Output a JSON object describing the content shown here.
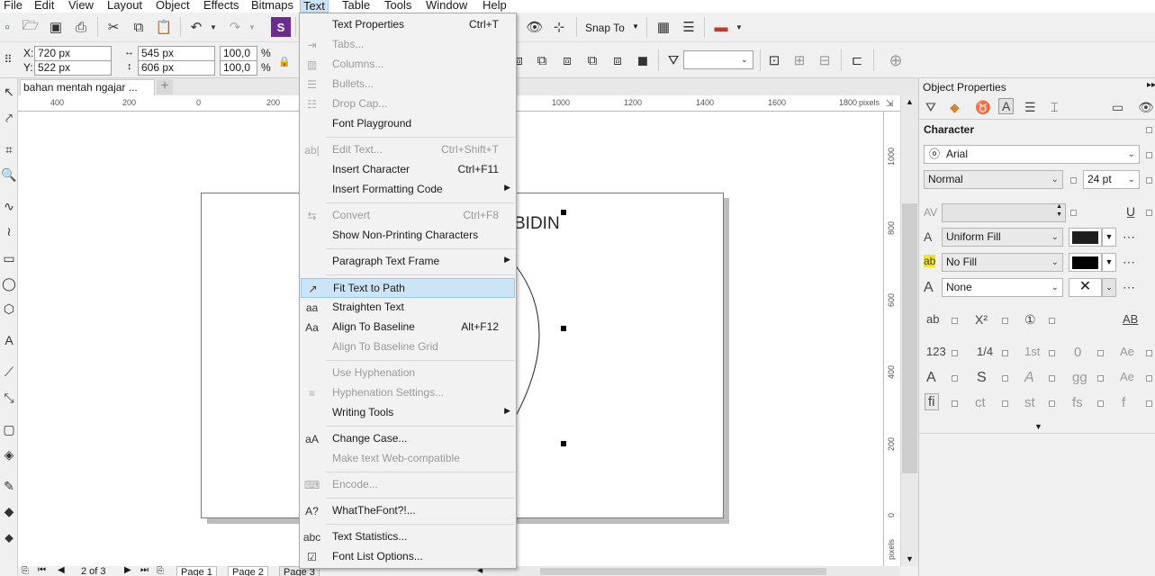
{
  "menubar": {
    "items": [
      "File",
      "Edit",
      "View",
      "Layout",
      "Object",
      "Effects",
      "Bitmaps",
      "Text",
      "Table",
      "Tools",
      "Window",
      "Help"
    ],
    "active": "Text"
  },
  "toolbar": {
    "snap_to": "Snap To",
    "x_label": "X:",
    "x_value": "720 px",
    "y_label": "Y:",
    "y_value": "522 px",
    "w_value": "545 px",
    "h_value": "606 px",
    "scale_w": "100,0",
    "scale_h": "100,0",
    "pct": "%"
  },
  "document": {
    "tab_title": "bahan mentah ngajar ...",
    "add_tab": "+",
    "canvas_text": "BIDIN",
    "pages_counter": "2 of 3",
    "pages": [
      "Page 1",
      "Page 2",
      "Page 3"
    ]
  },
  "ruler": {
    "h_labels": [
      "400",
      "200",
      "0",
      "200",
      "1000",
      "1200",
      "1400",
      "1600",
      "1800"
    ],
    "unit": "pixels",
    "v_labels": [
      "1000",
      "800",
      "600",
      "400",
      "200",
      "0"
    ],
    "v_unit": "pixels"
  },
  "text_menu": {
    "items": [
      {
        "label": "Text Properties",
        "shortcut": "Ctrl+T",
        "disabled": false,
        "icon": ""
      },
      {
        "label": "Tabs...",
        "shortcut": "",
        "disabled": true,
        "icon": "tabs-icon"
      },
      {
        "label": "Columns...",
        "shortcut": "",
        "disabled": true,
        "icon": "columns-icon"
      },
      {
        "label": "Bullets...",
        "shortcut": "",
        "disabled": true,
        "icon": "bullets-icon"
      },
      {
        "label": "Drop Cap...",
        "shortcut": "",
        "disabled": true,
        "icon": "drop-cap-icon"
      },
      {
        "label": "Font Playground",
        "shortcut": "",
        "disabled": false,
        "icon": ""
      },
      {
        "sep": true
      },
      {
        "label": "Edit Text...",
        "shortcut": "Ctrl+Shift+T",
        "disabled": true,
        "icon": "edit-text-icon"
      },
      {
        "label": "Insert Character",
        "shortcut": "Ctrl+F11",
        "disabled": false,
        "icon": ""
      },
      {
        "label": "Insert Formatting Code",
        "shortcut": "",
        "disabled": false,
        "icon": "",
        "submenu": true
      },
      {
        "sep": true
      },
      {
        "label": "Convert",
        "shortcut": "Ctrl+F8",
        "disabled": true,
        "icon": "convert-icon"
      },
      {
        "label": "Show Non-Printing Characters",
        "shortcut": "",
        "disabled": false,
        "icon": ""
      },
      {
        "sep": true
      },
      {
        "label": "Paragraph Text Frame",
        "shortcut": "",
        "disabled": false,
        "icon": "",
        "submenu": true
      },
      {
        "sep": true
      },
      {
        "label": "Fit Text to Path",
        "shortcut": "",
        "disabled": false,
        "icon": "fit-text-to-path-icon",
        "highlighted": true
      },
      {
        "label": "Straighten Text",
        "shortcut": "",
        "disabled": false,
        "icon": "straighten-text-icon"
      },
      {
        "label": "Align To Baseline",
        "shortcut": "Alt+F12",
        "disabled": false,
        "icon": "align-baseline-icon"
      },
      {
        "label": "Align To Baseline Grid",
        "shortcut": "",
        "disabled": true,
        "icon": ""
      },
      {
        "sep": true
      },
      {
        "label": "Use Hyphenation",
        "shortcut": "",
        "disabled": true,
        "icon": ""
      },
      {
        "label": "Hyphenation Settings...",
        "shortcut": "",
        "disabled": true,
        "icon": "hyphenation-icon"
      },
      {
        "label": "Writing Tools",
        "shortcut": "",
        "disabled": false,
        "icon": "",
        "submenu": true
      },
      {
        "sep": true
      },
      {
        "label": "Change Case...",
        "shortcut": "",
        "disabled": false,
        "icon": "change-case-icon"
      },
      {
        "label": "Make text Web-compatible",
        "shortcut": "",
        "disabled": true,
        "icon": ""
      },
      {
        "sep": true
      },
      {
        "label": "Encode...",
        "shortcut": "",
        "disabled": true,
        "icon": "encode-icon"
      },
      {
        "sep": true
      },
      {
        "label": "WhatTheFont?!...",
        "shortcut": "",
        "disabled": false,
        "icon": "whatthefont-icon"
      },
      {
        "sep": true
      },
      {
        "label": "Text Statistics...",
        "shortcut": "",
        "disabled": false,
        "icon": "text-statistics-icon"
      },
      {
        "label": "Font List Options...",
        "shortcut": "",
        "disabled": false,
        "icon": "font-list-icon"
      }
    ]
  },
  "docker": {
    "title": "Object Properties",
    "section": "Character",
    "font": "Arial",
    "style": "Normal",
    "size": "24 pt",
    "fill": "Uniform Fill",
    "fill_color": "#1e1e1e",
    "bg_fill": "No Fill",
    "bg_color": "#000000",
    "outline": "None",
    "glyphs": {
      "row1": [
        "ab",
        "X²",
        "①",
        "AB"
      ],
      "row2": [
        "123",
        "1/4",
        "1st",
        "0",
        "Ae"
      ],
      "row3": [
        "A",
        "S",
        "A",
        "gg",
        "Ae"
      ],
      "row4": [
        "fi",
        "ct",
        "st",
        "fs",
        "f"
      ]
    }
  }
}
